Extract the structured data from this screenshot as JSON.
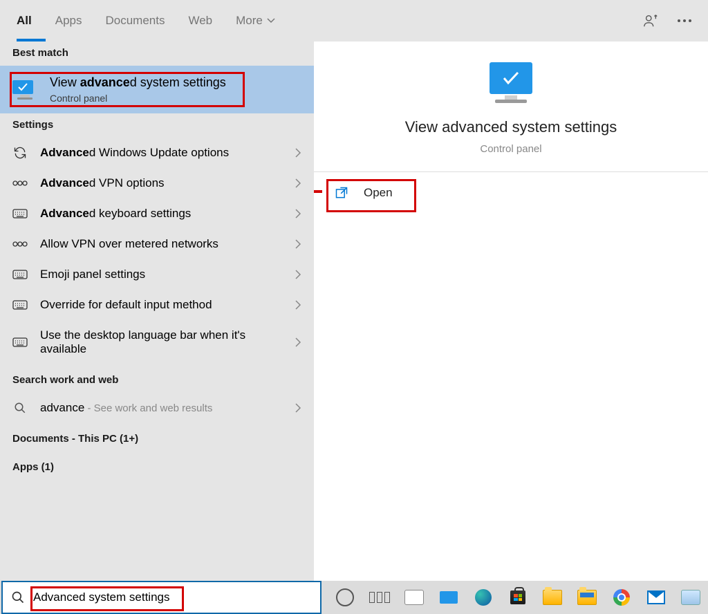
{
  "tabs": {
    "all": "All",
    "apps": "Apps",
    "documents": "Documents",
    "web": "Web",
    "more": "More"
  },
  "sections": {
    "best": "Best match",
    "settings": "Settings",
    "searchww": "Search work and web",
    "docs": "Documents - This PC (1+)",
    "apps": "Apps (1)"
  },
  "best_match": {
    "title_pre": "View ",
    "title_em": "advance",
    "title_post": "d system settings",
    "subtitle": "Control panel"
  },
  "settings_items": [
    {
      "icon": "refresh",
      "em": "Advance",
      "rest": "d Windows Update options"
    },
    {
      "icon": "vpn",
      "em": "Advance",
      "rest": "d VPN options"
    },
    {
      "icon": "keyboard",
      "em": "Advance",
      "rest": "d keyboard settings"
    },
    {
      "icon": "vpn",
      "em": "",
      "rest": "Allow VPN over metered networks"
    },
    {
      "icon": "keyboard",
      "em": "",
      "rest": "Emoji panel settings"
    },
    {
      "icon": "keyboard",
      "em": "",
      "rest": "Override for default input method"
    },
    {
      "icon": "keyboard",
      "em": "",
      "rest": "Use the desktop language bar when it's available"
    }
  ],
  "web_item": {
    "term": "advance",
    "tail": " - See work and web results"
  },
  "detail": {
    "title": "View advanced system settings",
    "subtitle": "Control panel",
    "open": "Open"
  },
  "search": {
    "value": "Advanced system settings"
  }
}
